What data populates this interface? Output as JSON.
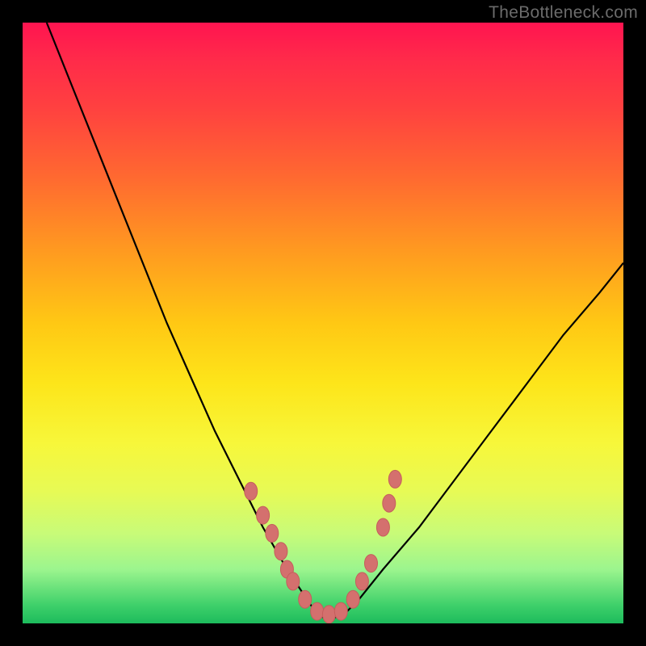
{
  "watermark": "TheBottleneck.com",
  "colors": {
    "frame": "#000000",
    "curve": "#000000",
    "marker_fill": "#d4706e",
    "marker_stroke": "#c55e5c",
    "gradient": [
      "#ff1450",
      "#ff4040",
      "#ff9a20",
      "#fde51a",
      "#c8fb78",
      "#1dbb5c"
    ]
  },
  "chart_data": {
    "type": "line",
    "title": "",
    "xlabel": "",
    "ylabel": "",
    "xlim": [
      0,
      100
    ],
    "ylim": [
      0,
      100
    ],
    "note": "axes are implied/unlabeled; values are approximate positions in percent of plot area, y=0 at bottom",
    "series": [
      {
        "name": "curve",
        "marked": false,
        "x": [
          4,
          8,
          12,
          16,
          20,
          24,
          28,
          32,
          36,
          40,
          44,
          48,
          50,
          52,
          54,
          56,
          60,
          66,
          72,
          78,
          84,
          90,
          96,
          100
        ],
        "y": [
          100,
          90,
          80,
          70,
          60,
          50,
          41,
          32,
          24,
          16,
          9,
          3,
          1,
          1,
          2,
          4,
          9,
          16,
          24,
          32,
          40,
          48,
          55,
          60
        ]
      },
      {
        "name": "markers",
        "marked": true,
        "x": [
          38,
          40,
          41.5,
          43,
          44,
          45,
          47,
          49,
          51,
          53,
          55,
          56.5,
          58,
          60,
          61,
          62
        ],
        "y": [
          22,
          18,
          15,
          12,
          9,
          7,
          4,
          2,
          1.5,
          2,
          4,
          7,
          10,
          16,
          20,
          24
        ]
      }
    ]
  }
}
